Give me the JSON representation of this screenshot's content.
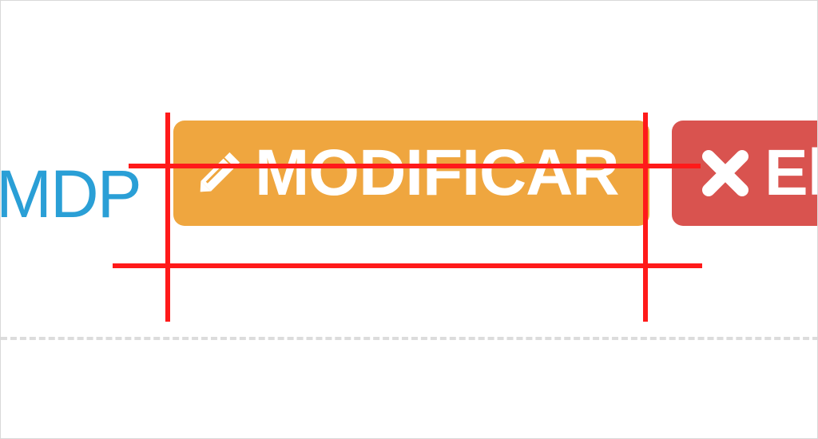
{
  "link": {
    "text": "MDP"
  },
  "actions": {
    "modify": {
      "label": "MODIFICAR",
      "icon": "pencil-icon",
      "color": "#efa63f"
    },
    "delete": {
      "label": "El",
      "icon": "close-icon",
      "color": "#d9534f"
    }
  },
  "colors": {
    "link": "#2a9fd6",
    "guide_lines": "#ff1a1a",
    "divider": "#dcdcdc"
  }
}
